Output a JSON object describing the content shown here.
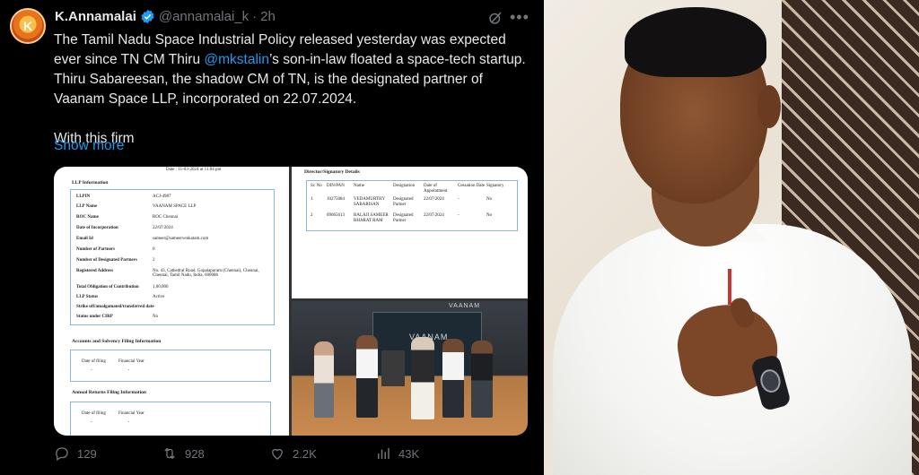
{
  "tweet": {
    "author_name": "K.Annamalai",
    "author_handle": "@annamalai_k",
    "separator": "·",
    "time": "2h",
    "avatar_initial": "K",
    "text_part1": "The Tamil Nadu Space Industrial Policy released yesterday was expected ever since TN CM Thiru ",
    "mention": "@mkstalin",
    "text_part2": "’s son-in-law floated a space-tech startup. Thiru Sabareesan, the shadow CM of TN, is the designated partner of Vaanam Space LLP, incorporated on 22.07.2024.",
    "text_line2": "With this firm",
    "show_more": "Show more",
    "icons": [
      "verified-badge-icon",
      "grok-icon",
      "more-options-icon",
      "reply-icon",
      "retweet-icon",
      "like-icon",
      "views-icon"
    ],
    "accent_color": "#1d9bf0"
  },
  "actions": {
    "replies": "129",
    "retweets": "928",
    "likes": "2.2K",
    "views": "43K"
  },
  "llp_document": {
    "top_note": "Date : 11-03-2024 at 11:04 pm",
    "heading": "LLP Information",
    "rows": [
      {
        "label": "LLPIN",
        "value": "ACJ-4987"
      },
      {
        "label": "LLP Name",
        "value": "VAANAM SPACE LLP"
      },
      {
        "label": "ROC Name",
        "value": "ROC Chennai"
      },
      {
        "label": "Date of Incorporation",
        "value": "22/07/2024"
      },
      {
        "label": "Email Id",
        "value": "sameer@sameervenkatam.com"
      },
      {
        "label": "Number of Partners",
        "value": "0"
      },
      {
        "label": "Number of Designated Partners",
        "value": "2"
      },
      {
        "label": "Registered Address",
        "value": "No. 43, Cathedral Road, Gopalapuram (Chennai), Chennai, Chennai, Tamil Nadu, India, 600086"
      },
      {
        "label": "Total Obligation of Contribution",
        "value": "1,00,000"
      },
      {
        "label": "LLP Status",
        "value": "Active"
      },
      {
        "label": "Strike off/amalgamated/transferred date",
        "value": "-"
      },
      {
        "label": "Status under CIRP",
        "value": "No"
      }
    ],
    "section2": "Accounts and Solvency Filing Information",
    "section2_cols": [
      "Date of filing",
      "Financial Year"
    ],
    "section3": "Annual Returns Filing Information",
    "section3_cols": [
      "Date of filing",
      "Financial Year"
    ],
    "dash": "-"
  },
  "signatory_document": {
    "heading": "Director/Signatory Details",
    "columns": [
      "Sr. No",
      "DIN/PAN",
      "Name",
      "Designation",
      "Date of Appointment",
      "Cessation Date",
      "Signatory"
    ],
    "rows": [
      [
        "1",
        "10275084",
        "VEDAMURTHY SABARISAN",
        "Designated Partner",
        "22/07/2024",
        "-",
        "No"
      ],
      [
        "2",
        "09065613",
        "BALAJI SAMEER BHARAT RAM",
        "Designated Partner",
        "22/07/2024",
        "-",
        "No"
      ]
    ]
  },
  "photo": {
    "backdrop_text": "VAANAM"
  }
}
